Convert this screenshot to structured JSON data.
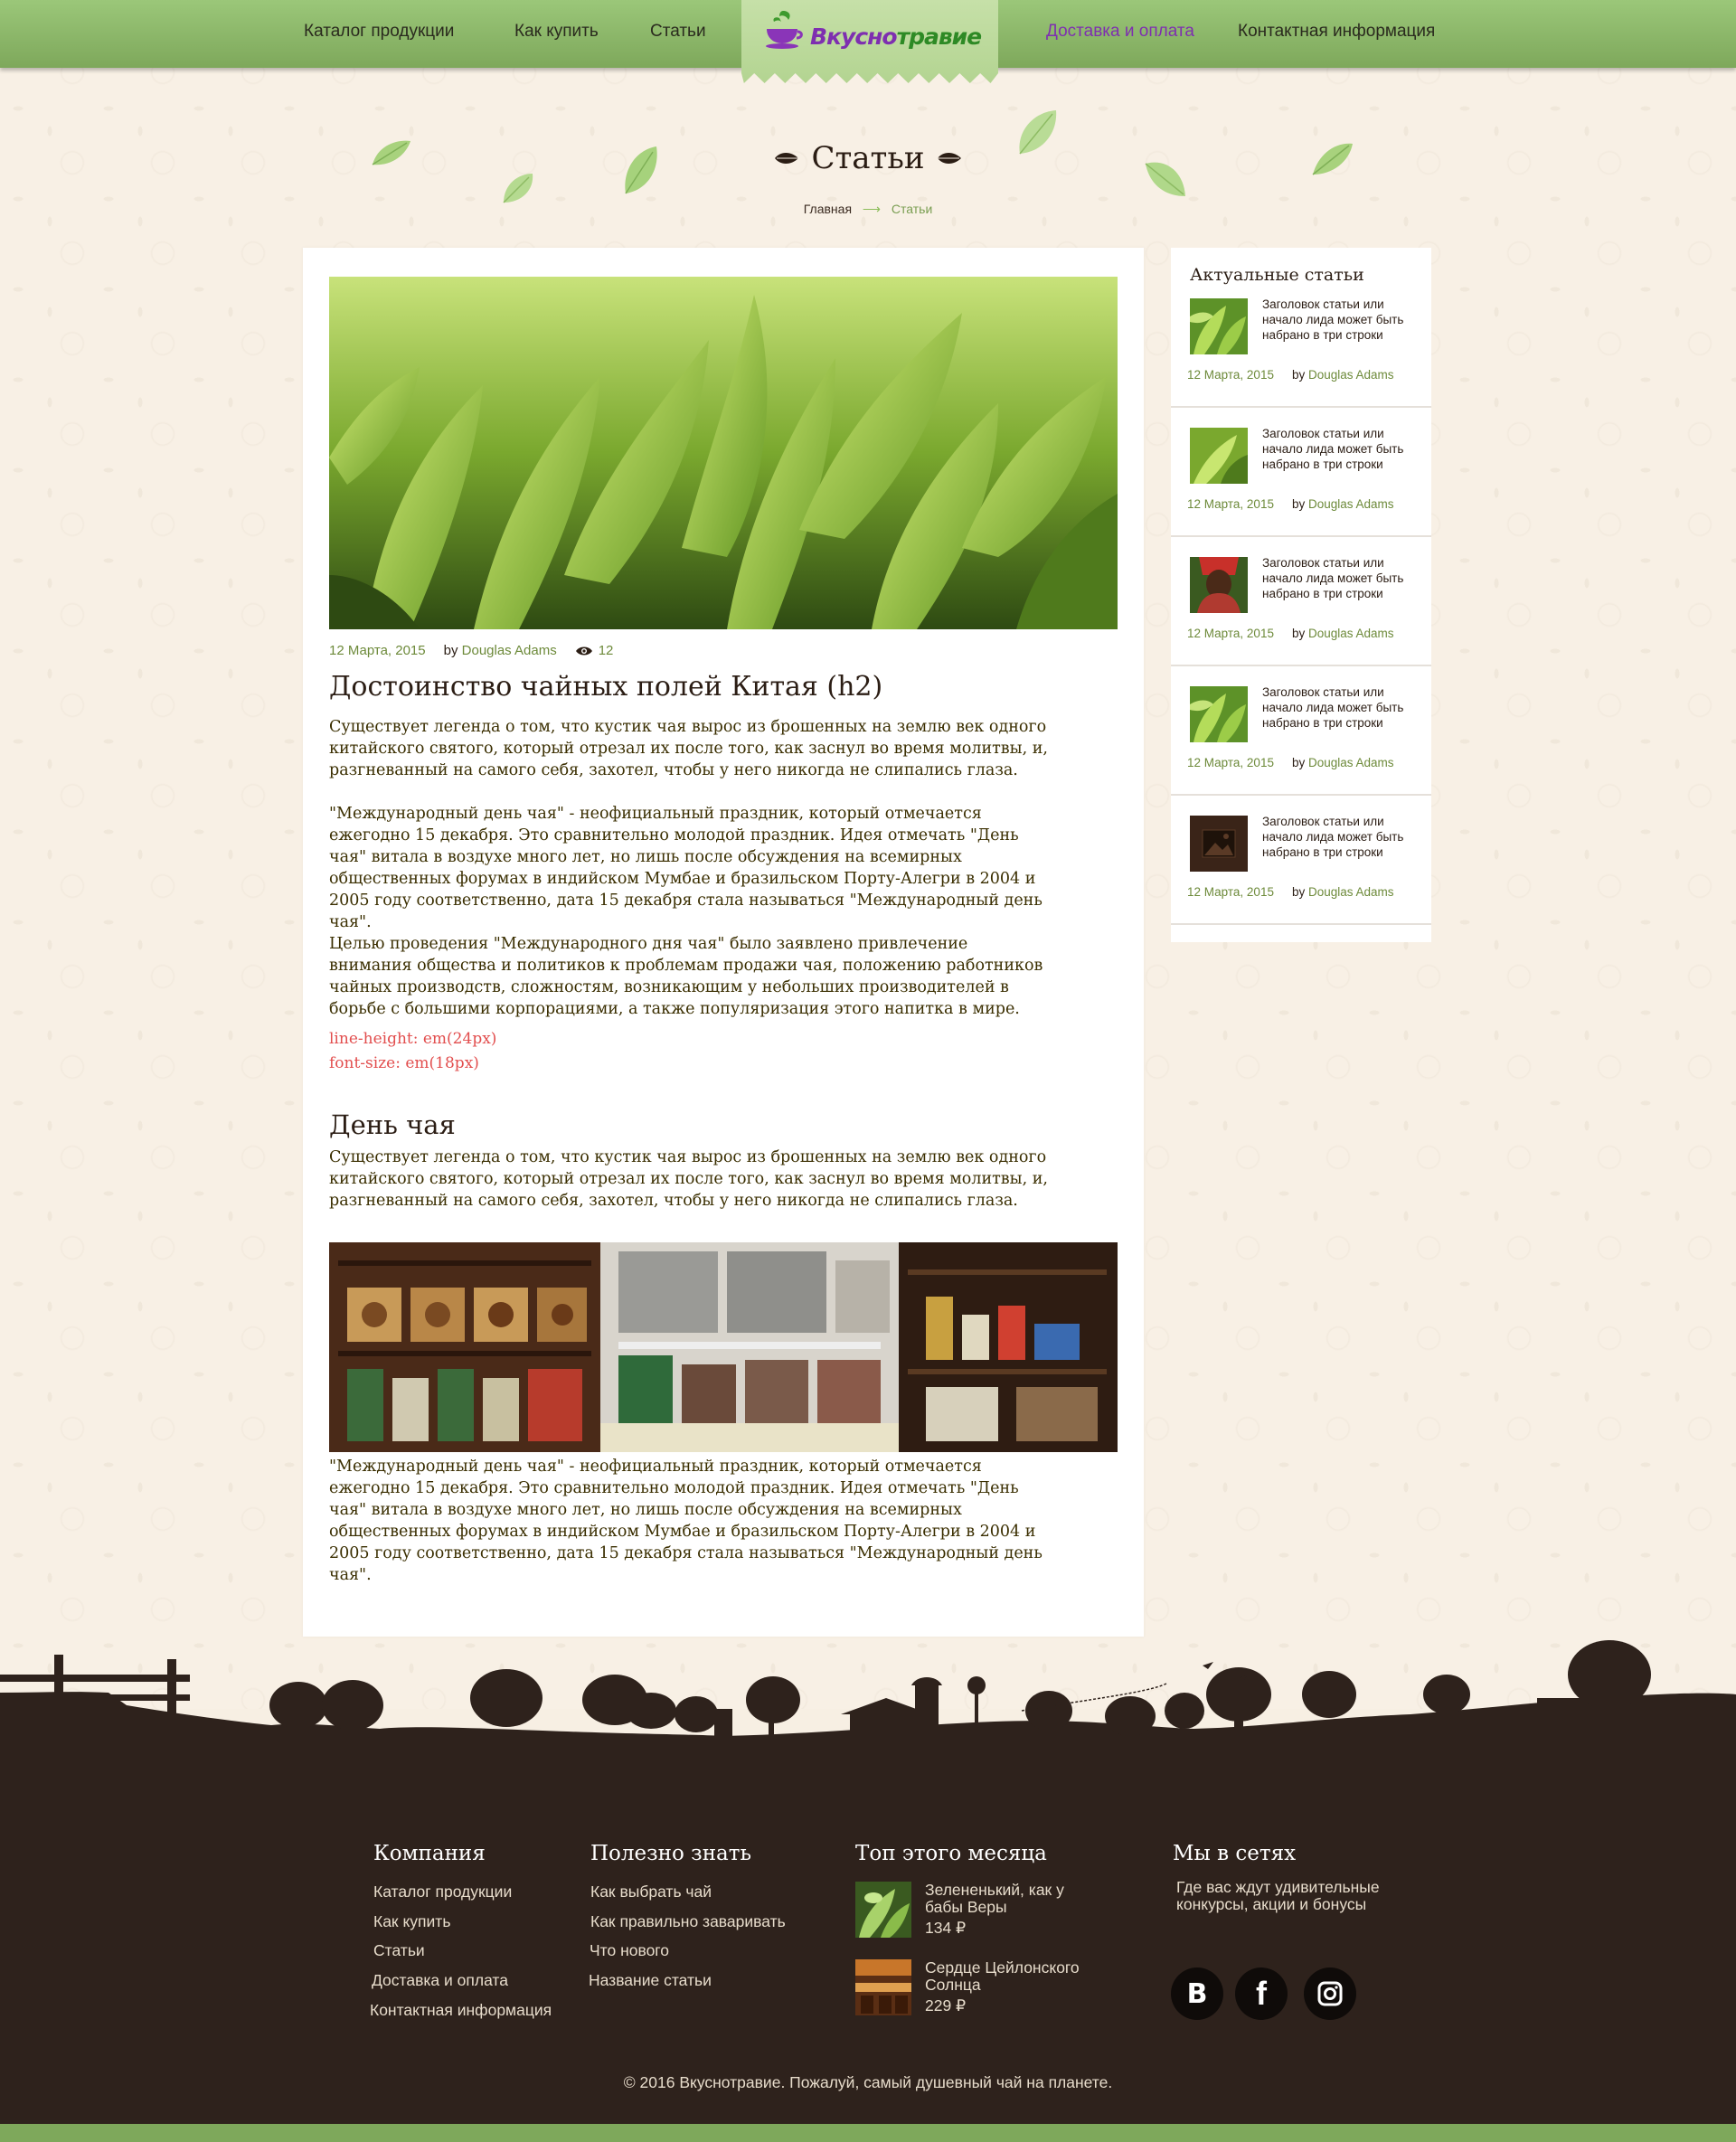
{
  "nav": {
    "items": [
      {
        "label": "Каталог продукции"
      },
      {
        "label": "Как купить"
      },
      {
        "label": "Статьи"
      },
      {
        "label": "Доставка и оплата",
        "active": true
      },
      {
        "label": "Контактная информация"
      }
    ],
    "logo": {
      "part1": "Вкусно",
      "part2": "травие"
    }
  },
  "page": {
    "title": "Статьи",
    "breadcrumb": {
      "home": "Главная",
      "arrow": "⟶",
      "current": "Статьи"
    }
  },
  "article": {
    "date": "12 Марта, 2015",
    "by": "by",
    "author": "Douglas Adams",
    "views": "12",
    "h2": "Достоинство чайных полей Китая (h2)",
    "p1": "Существует легенда о том, что кустик чая вырос из брошенных на землю век одного китайского святого, который отрезал их после того, как заснул во время молитвы, и, разгневанный на самого себя, захотел, чтобы у него никогда не слипались глаза.",
    "p2": "\"Международный день чая\" - неофициальный праздник, который отмечается ежегодно 15 декабря. Это сравнительно молодой праздник. Идея отмечать \"День чая\" витала в воздухе много лет, но лишь после обсуждения на всемирных общественных форумах в индийском Мумбае и бразильском Порту-Алегри в 2004 и 2005 году соответственно, дата 15 декабря стала называться \"Международный день чая\".",
    "p3": "Целью проведения \"Международного дня чая\" было заявлено привлечение внимания общества и политиков к проблемам продажи чая, положению работников чайных производств, сложностям, возникающим у небольших производителей в борьбе с большими корпорациями, а также популяризация этого напитка в мире.",
    "note1": "line-height: em(24px)",
    "note2": "font-size: em(18px)",
    "h3": "День чая",
    "p4": "Существует легенда о том, что кустик чая вырос из брошенных на землю век одного китайского святого, который отрезал их после того, как заснул во время молитвы, и, разгневанный на самого себя, захотел, чтобы у него никогда не слипались глаза.",
    "p5": "\"Международный день чая\" - неофициальный праздник, который отмечается ежегодно 15 декабря. Это сравнительно молодой праздник. Идея отмечать \"День чая\" витала в воздухе много лет, но лишь после обсуждения на всемирных общественных форумах в индийском Мумбае и бразильском Порту-Алегри в 2004 и 2005 году соответственно, дата 15 декабря стала называться \"Международный день чая\"."
  },
  "sidebar": {
    "title": "Актуальные статьи",
    "items": [
      {
        "text": "Заголовок статьи или начало лида может быть набрано в три строки",
        "date": "12 Марта, 2015",
        "by": "by",
        "author": "Douglas Adams",
        "thumb": "tea-leaves"
      },
      {
        "text": "Заголовок статьи или начало лида может быть набрано в три строки",
        "date": "12 Марта, 2015",
        "by": "by",
        "author": "Douglas Adams",
        "thumb": "tea-leaves"
      },
      {
        "text": "Заголовок статьи или начало лида может быть набрано в три строки",
        "date": "12 Марта, 2015",
        "by": "by",
        "author": "Douglas Adams",
        "thumb": "tea-picker"
      },
      {
        "text": "Заголовок статьи или начало лида может быть набрано в три строки",
        "date": "12 Марта, 2015",
        "by": "by",
        "author": "Douglas Adams",
        "thumb": "tea-leaves"
      },
      {
        "text": "Заголовок статьи или начало лида может быть набрано в три строки",
        "date": "12 Марта, 2015",
        "by": "by",
        "author": "Douglas Adams",
        "thumb": "image-placeholder"
      }
    ]
  },
  "footer": {
    "company": {
      "title": "Компания",
      "links": [
        "Каталог продукции",
        "Как купить",
        "Статьи",
        "Доставка и оплата",
        "Контактная информация"
      ]
    },
    "useful": {
      "title": "Полезно знать",
      "links": [
        "Как выбрать чай",
        "Как правильно заваривать",
        "Что нового",
        "Название статьи"
      ]
    },
    "top": {
      "title": "Топ этого месяца",
      "items": [
        {
          "name": "Зелененький, как у бабы Веры",
          "price": "134 ₽"
        },
        {
          "name": "Сердце Цейлонского Солнца",
          "price": "229 ₽"
        }
      ]
    },
    "social": {
      "title": "Мы в сетях",
      "text": "Где вас ждут удивительные конкурсы, акции и бонусы",
      "networks": [
        {
          "icon": "vk-icon",
          "glyph": "B"
        },
        {
          "icon": "facebook-icon",
          "glyph": "f"
        },
        {
          "icon": "instagram-icon",
          "glyph": ""
        }
      ]
    },
    "copyright": "© 2016 Вкуснотравие. Пожалуй, самый душевный чай на планете."
  },
  "colors": {
    "nav_green": "#8bb868",
    "accent_purple": "#7e2fb0",
    "link_green": "#6d8a3a",
    "footer_brown": "#2e221c",
    "note_red": "#e24d4d"
  }
}
